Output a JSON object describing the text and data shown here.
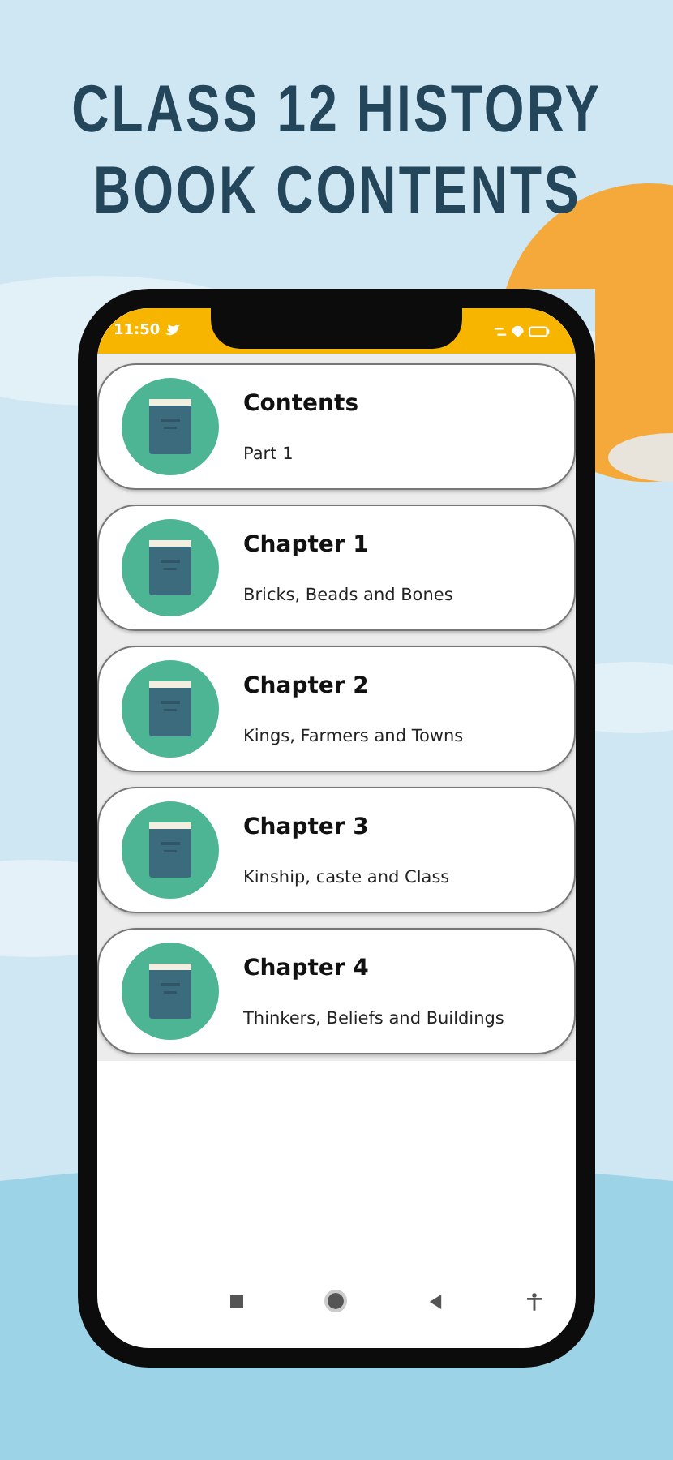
{
  "headline": [
    "CLASS 12 HISTORY",
    "BOOK CONTENTS"
  ],
  "status_bar": {
    "time": "11:50"
  },
  "items": [
    {
      "title": "Contents",
      "subtitle": "Part 1"
    },
    {
      "title": "Chapter 1",
      "subtitle": "Bricks, Beads and Bones"
    },
    {
      "title": "Chapter 2",
      "subtitle": "Kings, Farmers and Towns"
    },
    {
      "title": "Chapter 3",
      "subtitle": "Kinship, caste and Class"
    },
    {
      "title": "Chapter 4",
      "subtitle": "Thinkers, Beliefs and Buildings"
    }
  ]
}
